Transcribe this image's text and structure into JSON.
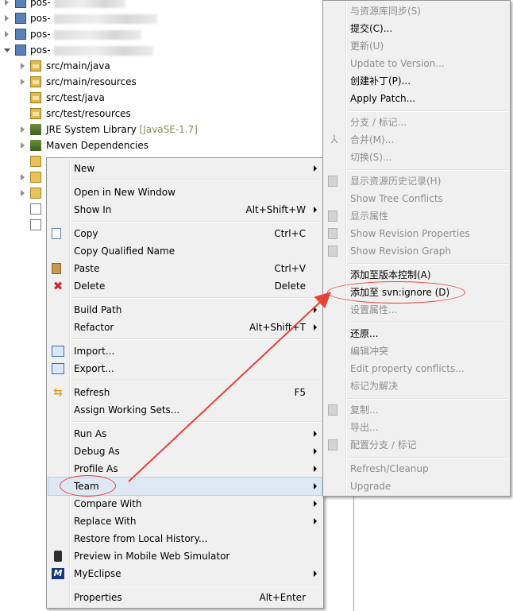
{
  "tree": {
    "projects": [
      {
        "prefix": "pos-"
      },
      {
        "prefix": "pos-"
      },
      {
        "prefix": "pos-"
      },
      {
        "prefix": "pos-"
      }
    ],
    "children": [
      {
        "label": "src/main/java"
      },
      {
        "label": "src/main/resources"
      },
      {
        "label": "src/test/java"
      },
      {
        "label": "src/test/resources"
      },
      {
        "label": "JRE System Library",
        "tag": "[JavaSE-1.7]"
      },
      {
        "label": "Maven Dependencies"
      }
    ]
  },
  "context_menu": {
    "items": [
      {
        "label": "New",
        "accel": ""
      },
      {
        "label": "Open in New Window",
        "accel": ""
      },
      {
        "label": "Show In",
        "accel": "Alt+Shift+W"
      },
      {
        "label": "Copy",
        "accel": "Ctrl+C"
      },
      {
        "label": "Copy Qualified Name",
        "accel": ""
      },
      {
        "label": "Paste",
        "accel": "Ctrl+V"
      },
      {
        "label": "Delete",
        "accel": "Delete"
      },
      {
        "label": "Build Path",
        "accel": ""
      },
      {
        "label": "Refactor",
        "accel": "Alt+Shift+T"
      },
      {
        "label": "Import...",
        "accel": ""
      },
      {
        "label": "Export...",
        "accel": ""
      },
      {
        "label": "Refresh",
        "accel": "F5"
      },
      {
        "label": "Assign Working Sets...",
        "accel": ""
      },
      {
        "label": "Run As",
        "accel": ""
      },
      {
        "label": "Debug As",
        "accel": ""
      },
      {
        "label": "Profile As",
        "accel": ""
      },
      {
        "label": "Team",
        "accel": ""
      },
      {
        "label": "Compare With",
        "accel": ""
      },
      {
        "label": "Replace With",
        "accel": ""
      },
      {
        "label": "Restore from Local History...",
        "accel": ""
      },
      {
        "label": "Preview in Mobile Web Simulator",
        "accel": ""
      },
      {
        "label": "MyEclipse",
        "accel": ""
      },
      {
        "label": "Properties",
        "accel": "Alt+Enter"
      }
    ]
  },
  "team_menu": {
    "items": [
      {
        "label": "与资源库同步(S)"
      },
      {
        "label": "提交(C)..."
      },
      {
        "label": "更新(U)"
      },
      {
        "label": "Update to Version..."
      },
      {
        "label": "创建补丁(P)..."
      },
      {
        "label": "Apply Patch..."
      },
      {
        "label": "分支 / 标记..."
      },
      {
        "label": "合并(M)..."
      },
      {
        "label": "切换(S)..."
      },
      {
        "label": "显示资源历史记录(H)"
      },
      {
        "label": "Show Tree Conflicts"
      },
      {
        "label": "显示属性"
      },
      {
        "label": "Show Revision Properties"
      },
      {
        "label": "Show Revision Graph"
      },
      {
        "label": "添加至版本控制(A)"
      },
      {
        "label": "添加至 svn:ignore (D)"
      },
      {
        "label": "设置属性..."
      },
      {
        "label": "还原..."
      },
      {
        "label": "编辑冲突"
      },
      {
        "label": "Edit property conflicts..."
      },
      {
        "label": "标记为解决"
      },
      {
        "label": "复制..."
      },
      {
        "label": "导出..."
      },
      {
        "label": "配置分支 / 标记"
      },
      {
        "label": "Refresh/Cleanup"
      },
      {
        "label": "Upgrade"
      }
    ]
  },
  "colors": {
    "annotation": "#e8403a",
    "menu_bg": "#f0f0f0",
    "disabled_text": "#8d8d8d"
  }
}
